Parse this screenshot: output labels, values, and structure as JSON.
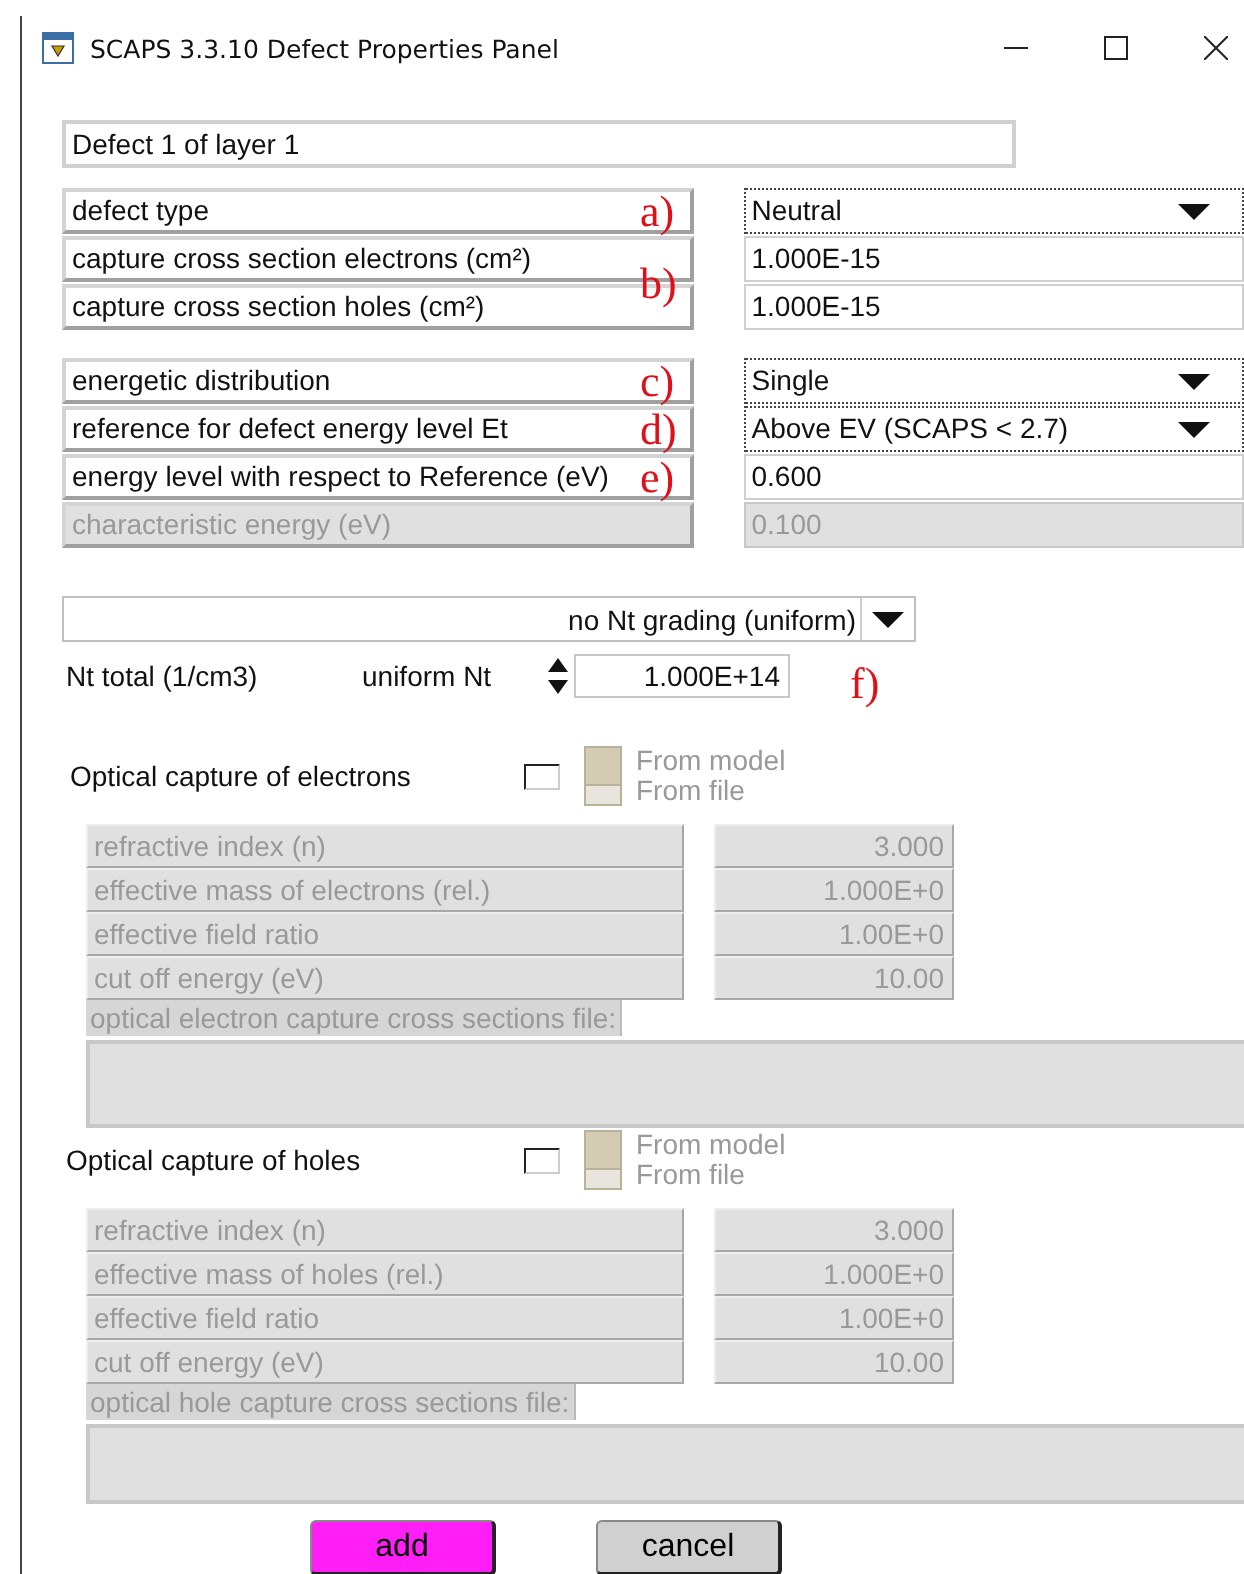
{
  "window": {
    "title": "SCAPS 3.3.10 Defect Properties Panel"
  },
  "defect_name": "Defect 1 of layer 1",
  "groups": [
    {
      "blocks": [
        {
          "annotation": "a)",
          "rows": [
            {
              "label": "defect type",
              "value": "Neutral",
              "kind": "dropdown",
              "disabled": false
            }
          ]
        },
        {
          "annotation": "b)",
          "rows": [
            {
              "label": "capture cross section electrons (cm²)",
              "value": "1.000E-15",
              "kind": "field",
              "disabled": false
            },
            {
              "label": "capture cross section holes (cm²)",
              "value": "1.000E-15",
              "kind": "field",
              "disabled": false
            }
          ]
        }
      ]
    },
    {
      "blocks": [
        {
          "annotation": "c)",
          "rows": [
            {
              "label": "energetic distribution",
              "value": "Single",
              "kind": "dropdown",
              "disabled": false
            }
          ]
        },
        {
          "annotation": "d)",
          "rows": [
            {
              "label": "reference for defect energy level Et",
              "value": "Above EV (SCAPS < 2.7)",
              "kind": "dropdown",
              "disabled": false
            }
          ]
        },
        {
          "annotation": "e)",
          "rows": [
            {
              "label": "energy level with respect to Reference (eV)",
              "value": "0.600",
              "kind": "field",
              "disabled": false
            }
          ]
        },
        {
          "rows": [
            {
              "label": "characteristic energy (eV)",
              "value": "0.100",
              "kind": "field",
              "disabled": true
            }
          ]
        }
      ]
    }
  ],
  "grading": {
    "value": "no Nt grading (uniform)"
  },
  "nt": {
    "label": "Nt total (1/cm3)",
    "mode": "uniform Nt",
    "value": "1.000E+14",
    "annotation": "f)"
  },
  "optical": [
    {
      "title": "Optical capture of electrons",
      "checked": false,
      "options": [
        {
          "label": "From model",
          "selected": true
        },
        {
          "label": "From file",
          "selected": false
        }
      ],
      "params": [
        {
          "label": "refractive index (n)",
          "value": "3.000"
        },
        {
          "label": "effective mass of electrons (rel.)",
          "value": "1.000E+0"
        },
        {
          "label": "effective field ratio",
          "value": "1.00E+0"
        },
        {
          "label": "cut off energy (eV)",
          "value": "10.00"
        }
      ],
      "file_label": "optical electron capture cross sections file:"
    },
    {
      "title": "Optical capture of holes",
      "checked": false,
      "options": [
        {
          "label": "From model",
          "selected": true
        },
        {
          "label": "From file",
          "selected": false
        }
      ],
      "params": [
        {
          "label": "refractive index (n)",
          "value": "3.000"
        },
        {
          "label": "effective mass of holes (rel.)",
          "value": "1.000E+0"
        },
        {
          "label": "effective field ratio",
          "value": "1.00E+0"
        },
        {
          "label": "cut off energy (eV)",
          "value": "10.00"
        }
      ],
      "file_label": "optical hole capture cross sections file:"
    }
  ],
  "buttons": [
    {
      "label": "add",
      "kind": "primary"
    },
    {
      "label": "cancel",
      "kind": "normal"
    }
  ]
}
